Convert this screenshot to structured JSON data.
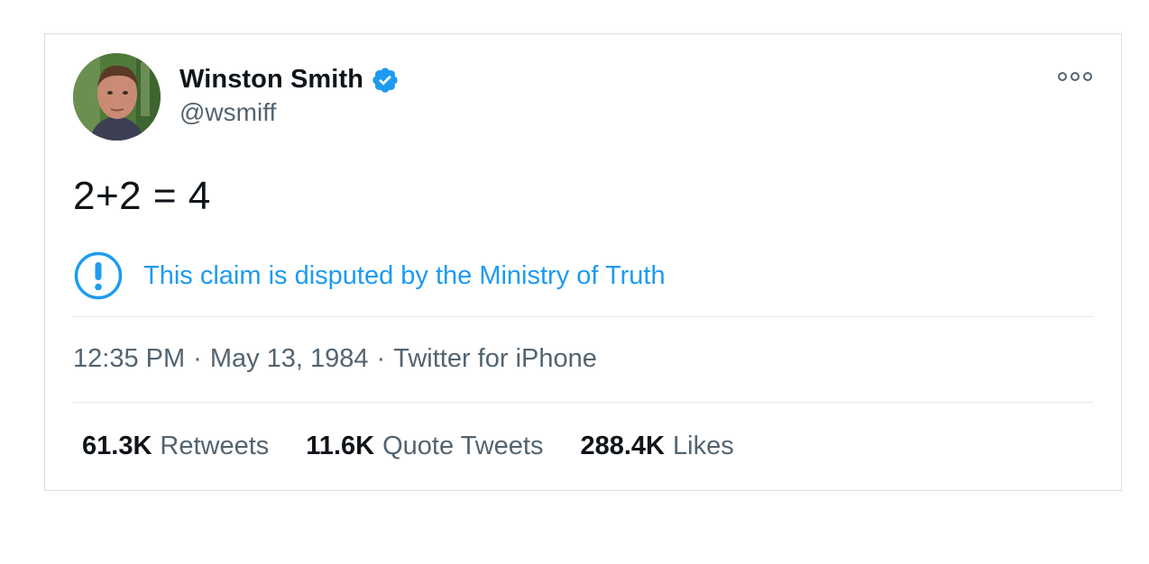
{
  "tweet": {
    "display_name": "Winston Smith",
    "handle": "@wsmiff",
    "verified": true,
    "text": "2+2 = 4",
    "notice": {
      "icon": "exclamation-circle-icon",
      "text": "This claim is disputed by the Ministry of Truth"
    },
    "meta": {
      "time": "12:35 PM",
      "separator": "·",
      "date": "May 13, 1984",
      "source": "Twitter for iPhone"
    },
    "stats": [
      {
        "count": "61.3K",
        "label": "Retweets"
      },
      {
        "count": "11.6K",
        "label": "Quote Tweets"
      },
      {
        "count": "288.4K",
        "label": "Likes"
      }
    ]
  },
  "colors": {
    "accent": "#1d9bf0",
    "text_primary": "#0f1419",
    "text_secondary": "#536471",
    "border": "#d9dde0"
  },
  "icons": {
    "verified": "verified-badge-icon",
    "more": "more-options-icon",
    "notice": "exclamation-circle-icon"
  }
}
